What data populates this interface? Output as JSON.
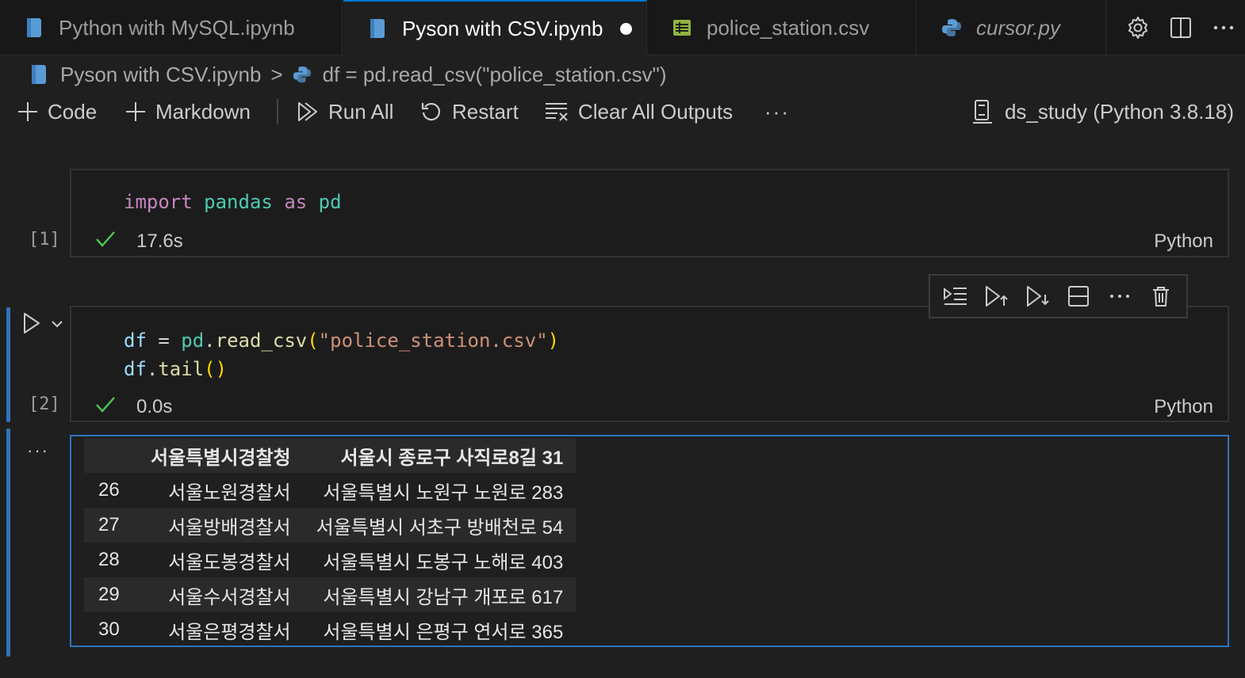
{
  "tabs": [
    {
      "label": "Python with MySQL.ipynb",
      "icon": "notebook-icon",
      "active": false
    },
    {
      "label": "Pyson with CSV.ipynb",
      "icon": "notebook-icon",
      "active": true,
      "dirty": true
    },
    {
      "label": "police_station.csv",
      "icon": "csv-table-icon",
      "active": false
    },
    {
      "label": "cursor.py",
      "icon": "python-icon",
      "active": false,
      "italic": true
    }
  ],
  "tab_actions": [
    "gear-icon",
    "split-editor-icon",
    "more-icon"
  ],
  "breadcrumb": {
    "file": "Pyson with CSV.ipynb",
    "separator": ">",
    "cell": "df = pd.read_csv(\"police_station.csv\")"
  },
  "toolbar": {
    "code_label": "Code",
    "markdown_label": "Markdown",
    "run_all_label": "Run All",
    "restart_label": "Restart",
    "clear_outputs_label": "Clear All Outputs",
    "more_label": "···",
    "kernel_label": "ds_study (Python 3.8.18)"
  },
  "cells": [
    {
      "exec_count": "[1]",
      "code_tokens": {
        "kw1": "import",
        "mod1": "pandas",
        "kw2": "as",
        "mod2": "pd"
      },
      "status_time": "17.6s",
      "language": "Python"
    },
    {
      "exec_count": "[2]",
      "code_lines": [
        "df = pd.read_csv(\"police_station.csv\")",
        "df.tail()"
      ],
      "status_time": "0.0s",
      "language": "Python"
    }
  ],
  "output": {
    "more_label": "···",
    "columns": [
      "",
      "서울특별시경찰청",
      "서울시 종로구 사직로8길 31"
    ],
    "rows": [
      [
        "26",
        "서울노원경찰서",
        "서울특별시 노원구 노원로 283"
      ],
      [
        "27",
        "서울방배경찰서",
        "서울특별시 서초구 방배천로 54"
      ],
      [
        "28",
        "서울도봉경찰서",
        "서울특별시 도봉구 노해로 403"
      ],
      [
        "29",
        "서울수서경찰서",
        "서울특별시 강남구 개포로 617"
      ],
      [
        "30",
        "서울은평경찰서",
        "서울특별시 은평구 연서로 365"
      ]
    ]
  },
  "colors": {
    "accent": "#0078d4",
    "focus_border": "#2f74c0",
    "success_check": "#4ec94e",
    "background": "#1f1f1f"
  }
}
